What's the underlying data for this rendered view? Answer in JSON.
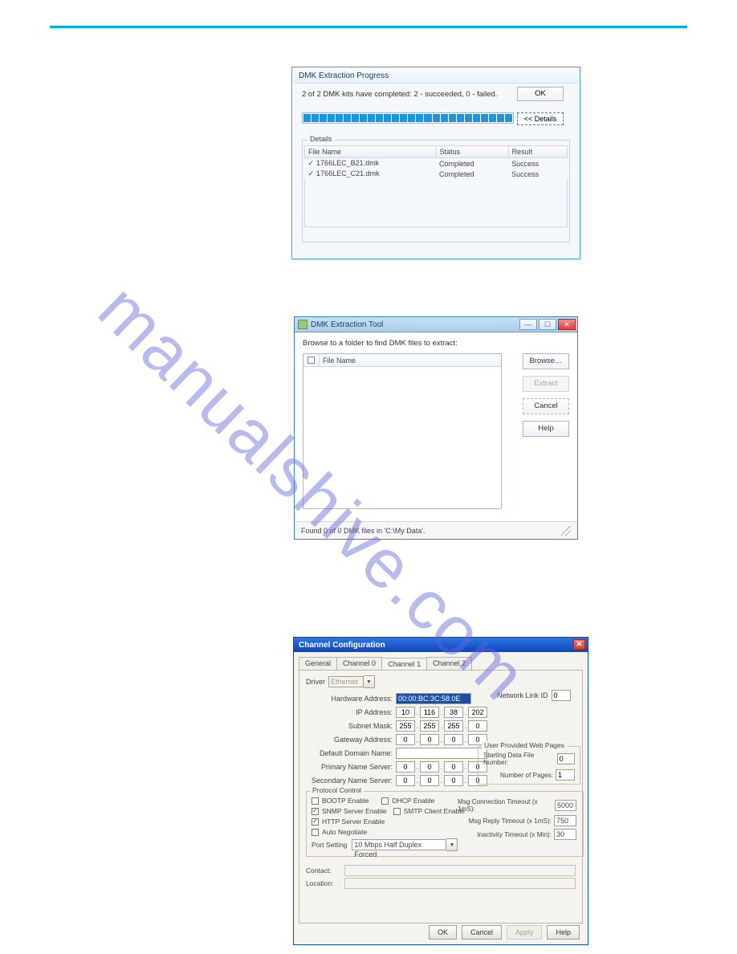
{
  "watermark": "manualshive.com",
  "dlg1": {
    "title": "DMK Extraction Progress",
    "message": "2 of 2 DMK kits have completed: 2 - succeeded, 0 - failed.",
    "ok_label": "OK",
    "details_btn": "<< Details",
    "details_legend": "Details",
    "columns": {
      "file": "File Name",
      "status": "Status",
      "result": "Result"
    },
    "rows": [
      {
        "file": "1766LEC_B21.dmk",
        "status": "Completed",
        "result": "Success"
      },
      {
        "file": "1766LEC_C21.dmk",
        "status": "Completed",
        "result": "Success"
      }
    ]
  },
  "dlg2": {
    "title": "DMK Extraction Tool",
    "prompt": "Browse to a folder to find DMK files to extract:",
    "col_file": "File Name",
    "browse": "Browse…",
    "extract": "Extract",
    "cancel": "Cancel",
    "help": "Help",
    "status": "Found 0 of 0 DMK files in 'C:\\My Data'."
  },
  "dlg3": {
    "title": "Channel Configuration",
    "tabs": {
      "general": "General",
      "ch0": "Channel 0",
      "ch1": "Channel 1",
      "ch2": "Channel 2"
    },
    "driver_label": "Driver",
    "driver_value": "Ethernet",
    "labels": {
      "hw": "Hardware Address:",
      "ip": "IP Address:",
      "subnet": "Subnet Mask:",
      "gateway": "Gateway Address:",
      "domain": "Default Domain Name:",
      "pdns": "Primary Name Server:",
      "sdns": "Secondary Name Server:",
      "netlink": "Network Link ID",
      "userpages": "User Provided Web Pages",
      "startfile": "Starting Data File Number:",
      "numpages": "Number of Pages:",
      "proto": "Protocol Control",
      "bootp": "BOOTP Enable",
      "dhcp": "DHCP Enable",
      "snmps": "SNMP Server Enable",
      "smtpc": "SMTP Client Enable",
      "https": "HTTP Server Enable",
      "autoneg": "Auto Negotiate",
      "msgconn": "Msg Connection Timeout (x 1mS):",
      "msgreply": "Msg Reply Timeout (x 1mS):",
      "inact": "Inactivity Timeout (x Min):",
      "portset": "Port Setting",
      "portval": "10 Mbps Half Duplex Forced",
      "contact": "Contact:",
      "location": "Location:"
    },
    "values": {
      "hw": "00:00:BC:3C:58:0E",
      "ip": [
        "10",
        "116",
        "38",
        "202"
      ],
      "subnet": [
        "255",
        "255",
        "255",
        "0"
      ],
      "gateway": [
        "0",
        "0",
        "0",
        "0"
      ],
      "domain": "",
      "pdns": [
        "0",
        "0",
        "0",
        "0"
      ],
      "sdns": [
        "0",
        "0",
        "0",
        "0"
      ],
      "netlink": "0",
      "startfile": "0",
      "numpages": "1",
      "msgconn": "5000",
      "msgreply": "750",
      "inact": "30"
    },
    "checks": {
      "bootp": false,
      "dhcp": false,
      "snmps": true,
      "smtpc": false,
      "https": true,
      "autoneg": false
    },
    "buttons": {
      "ok": "OK",
      "cancel": "Cancel",
      "apply": "Apply",
      "help": "Help"
    }
  }
}
